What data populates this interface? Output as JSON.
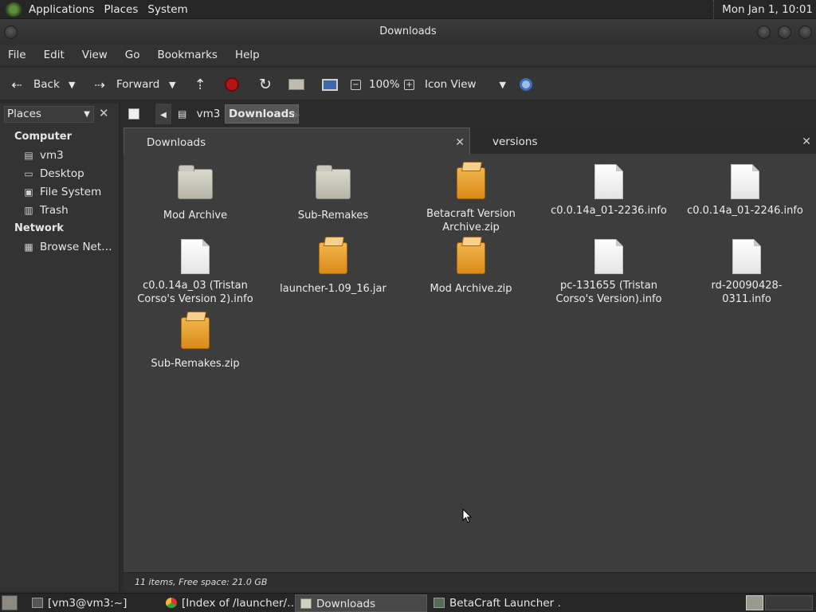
{
  "top_panel": {
    "menus": [
      "Applications",
      "Places",
      "System"
    ],
    "clock": "Mon Jan 1, 10:01"
  },
  "window": {
    "title": "Downloads"
  },
  "menubar": [
    "File",
    "Edit",
    "View",
    "Go",
    "Bookmarks",
    "Help"
  ],
  "toolbar": {
    "back_label": "Back",
    "forward_label": "Forward",
    "zoom": "100%",
    "view_mode": "Icon View"
  },
  "location": {
    "crumbs": [
      "vm3",
      "Downloads"
    ]
  },
  "sidebar": {
    "header": "Places",
    "sections": [
      {
        "title": "Computer",
        "items": [
          "vm3",
          "Desktop",
          "File System",
          "Trash"
        ]
      },
      {
        "title": "Network",
        "items": [
          "Browse Net…"
        ]
      }
    ]
  },
  "tabs": [
    "Downloads",
    "versions"
  ],
  "files": [
    {
      "name": "Mod Archive",
      "type": "folder"
    },
    {
      "name": "Sub-Remakes",
      "type": "folder"
    },
    {
      "name": "Betacraft Version Archive.zip",
      "type": "archive"
    },
    {
      "name": "c0.0.14a_01-2236.info",
      "type": "document"
    },
    {
      "name": "c0.0.14a_01-2246.info",
      "type": "document"
    },
    {
      "name": "c0.0.14a_03 (Tristan Corso's Version 2).info",
      "type": "document"
    },
    {
      "name": "launcher-1.09_16.jar",
      "type": "archive"
    },
    {
      "name": "Mod Archive.zip",
      "type": "archive"
    },
    {
      "name": "pc-131655 (Tristan Corso's Version).info",
      "type": "document"
    },
    {
      "name": "rd-20090428-0311.info",
      "type": "document"
    },
    {
      "name": "Sub-Remakes.zip",
      "type": "archive"
    }
  ],
  "status": "11 items, Free space: 21.0 GB",
  "taskbar": [
    {
      "label": "[vm3@vm3:~]",
      "icon": "terminal-icon"
    },
    {
      "label": "[Index of /launcher/…",
      "icon": "chrome-icon"
    },
    {
      "label": "Downloads",
      "icon": "folder-icon"
    },
    {
      "label": "BetaCraft Launcher …",
      "icon": "java-icon"
    }
  ]
}
